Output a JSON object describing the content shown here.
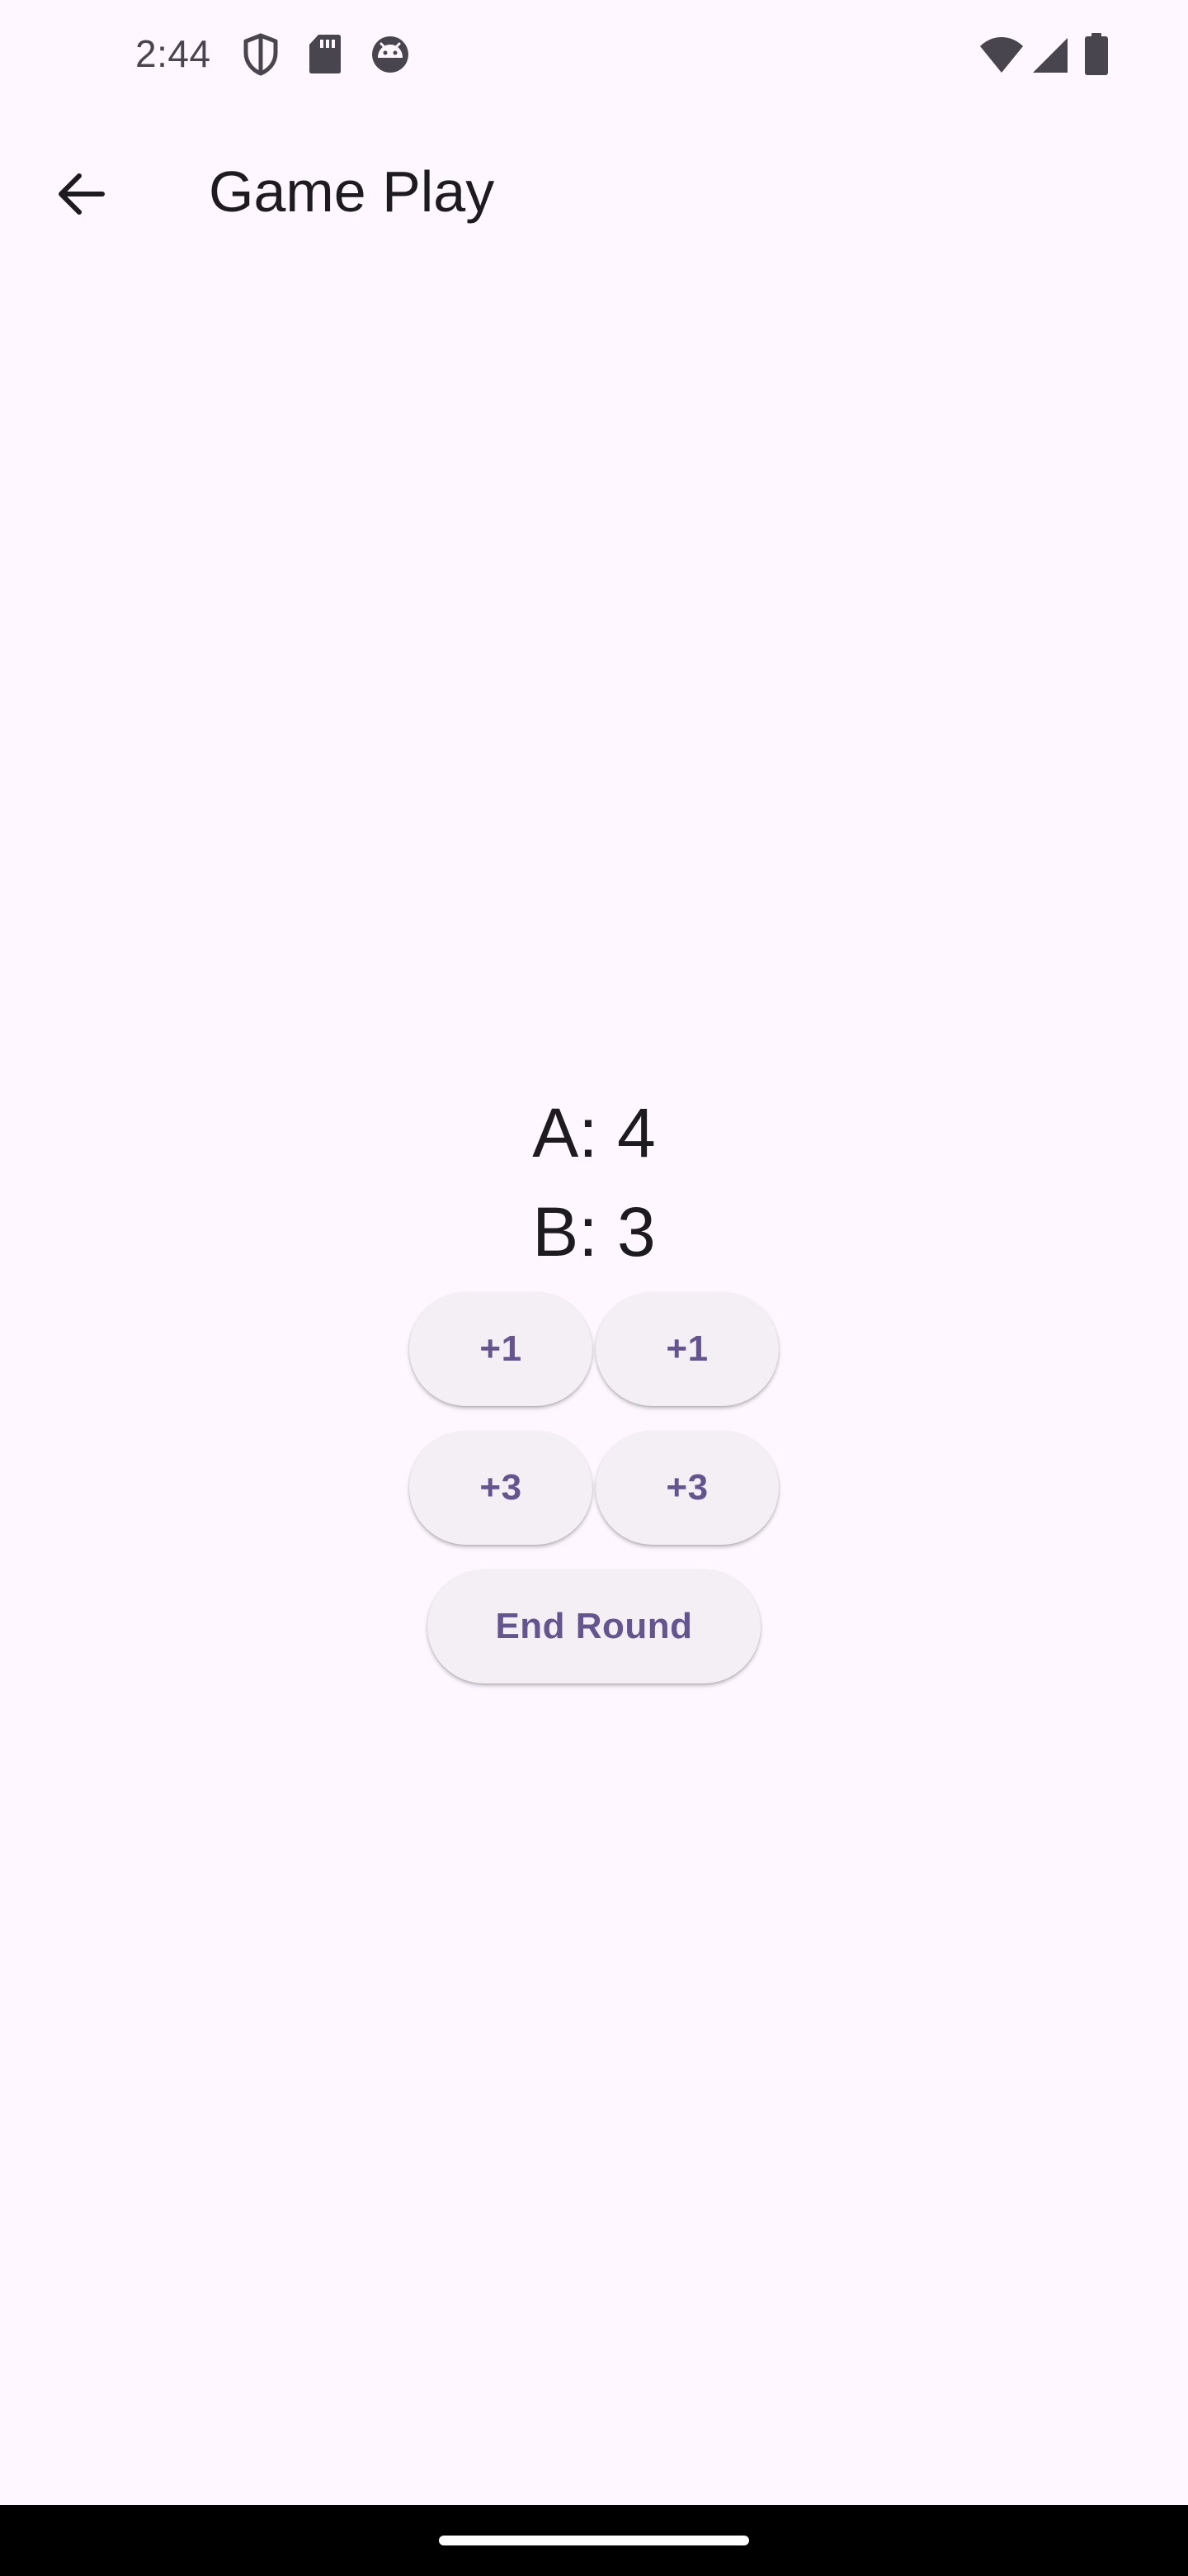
{
  "status_bar": {
    "time": "2:44",
    "left_icons": [
      "shield-icon",
      "sd-card-icon",
      "android-debug-icon"
    ],
    "right_icons": [
      "wifi-icon",
      "signal-icon",
      "battery-icon"
    ]
  },
  "app_bar": {
    "back_icon": "arrow-back-icon",
    "title": "Game Play"
  },
  "scores": {
    "team_a": "A: 4",
    "team_b": "B: 3"
  },
  "buttons": {
    "a_plus_one": "+1",
    "b_plus_one": "+1",
    "a_plus_three": "+3",
    "b_plus_three": "+3",
    "end_round": "End Round"
  },
  "colors": {
    "background": "#fef7ff",
    "button_surface": "#f4eff4",
    "button_text": "#65558f",
    "text_primary": "#1d1b20"
  }
}
